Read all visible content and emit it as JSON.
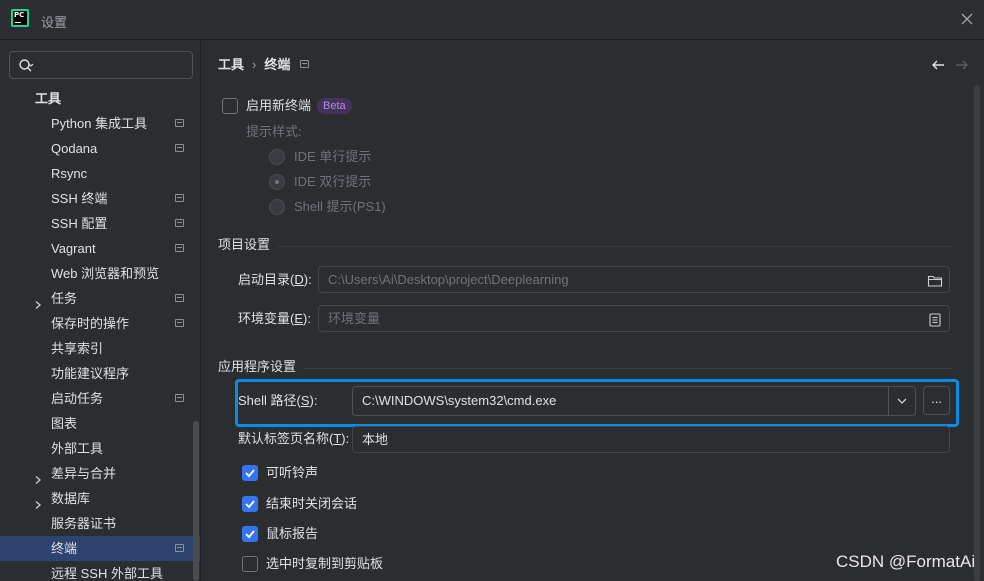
{
  "window": {
    "title": "设置",
    "logo_text": "PC"
  },
  "search": {
    "placeholder": "",
    "value": ""
  },
  "sidebar": {
    "items": [
      {
        "label": "工具",
        "level": "root",
        "page_icon": false,
        "chevron": false
      },
      {
        "label": "Python 集成工具",
        "level": "child",
        "page_icon": true,
        "chevron": false
      },
      {
        "label": "Qodana",
        "level": "child",
        "page_icon": true,
        "chevron": false
      },
      {
        "label": "Rsync",
        "level": "child",
        "page_icon": false,
        "chevron": false
      },
      {
        "label": "SSH 终端",
        "level": "child",
        "page_icon": true,
        "chevron": false
      },
      {
        "label": "SSH 配置",
        "level": "child",
        "page_icon": true,
        "chevron": false
      },
      {
        "label": "Vagrant",
        "level": "child",
        "page_icon": true,
        "chevron": false
      },
      {
        "label": "Web 浏览器和预览",
        "level": "child",
        "page_icon": false,
        "chevron": false
      },
      {
        "label": "任务",
        "level": "child",
        "page_icon": true,
        "chevron": true
      },
      {
        "label": "保存时的操作",
        "level": "child",
        "page_icon": true,
        "chevron": false
      },
      {
        "label": "共享索引",
        "level": "child",
        "page_icon": false,
        "chevron": false
      },
      {
        "label": "功能建议程序",
        "level": "child",
        "page_icon": false,
        "chevron": false
      },
      {
        "label": "启动任务",
        "level": "child",
        "page_icon": true,
        "chevron": false
      },
      {
        "label": "图表",
        "level": "child",
        "page_icon": false,
        "chevron": false
      },
      {
        "label": "外部工具",
        "level": "child",
        "page_icon": false,
        "chevron": false
      },
      {
        "label": "差异与合并",
        "level": "child",
        "page_icon": false,
        "chevron": true
      },
      {
        "label": "数据库",
        "level": "child",
        "page_icon": false,
        "chevron": true
      },
      {
        "label": "服务器证书",
        "level": "child",
        "page_icon": false,
        "chevron": false
      },
      {
        "label": "终端",
        "level": "child",
        "page_icon": true,
        "chevron": false,
        "selected": true
      },
      {
        "label": "远程 SSH 外部工具",
        "level": "child",
        "page_icon": false,
        "chevron": false
      }
    ]
  },
  "breadcrumb": {
    "parent": "工具",
    "separator": "›",
    "current": "终端"
  },
  "new_terminal": {
    "label": "启用新终端",
    "badge": "Beta",
    "checked": false,
    "prompt_style_label": "提示样式:",
    "options": [
      {
        "label": "IDE 单行提示",
        "selected": false
      },
      {
        "label": "IDE 双行提示",
        "selected": true
      },
      {
        "label": "Shell 提示(PS1)",
        "selected": false
      }
    ]
  },
  "project_settings": {
    "title": "项目设置",
    "start_dir_label_pre": "启动目录(",
    "start_dir_mnemonic": "D",
    "start_dir_label_post": "):",
    "start_dir_value": "C:\\Users\\Ai\\Desktop\\project\\Deeplearning",
    "env_label_pre": "环境变量(",
    "env_mnemonic": "E",
    "env_label_post": "):",
    "env_placeholder": "环境变量"
  },
  "app_settings": {
    "title": "应用程序设置",
    "shell_label_pre": "Shell 路径(",
    "shell_mnemonic": "S",
    "shell_label_post": "):",
    "shell_value": "C:\\WINDOWS\\system32\\cmd.exe",
    "browse_label": "...",
    "tab_name_label_pre": "默认标签页名称(",
    "tab_name_mnemonic": "T",
    "tab_name_label_post": "):",
    "tab_name_value": "本地",
    "checkboxes": [
      {
        "label": "可听铃声",
        "checked": true
      },
      {
        "label": "结束时关闭会话",
        "checked": true
      },
      {
        "label": "鼠标报告",
        "checked": true
      },
      {
        "label": "选中时复制到剪贴板",
        "checked": false
      }
    ]
  },
  "watermark": "CSDN @FormatAi",
  "colors": {
    "accent": "#3574f0",
    "highlight": "#0a8de8",
    "selection": "#2e436e",
    "beta_bg": "#433358",
    "beta_fg": "#b78ae6"
  }
}
